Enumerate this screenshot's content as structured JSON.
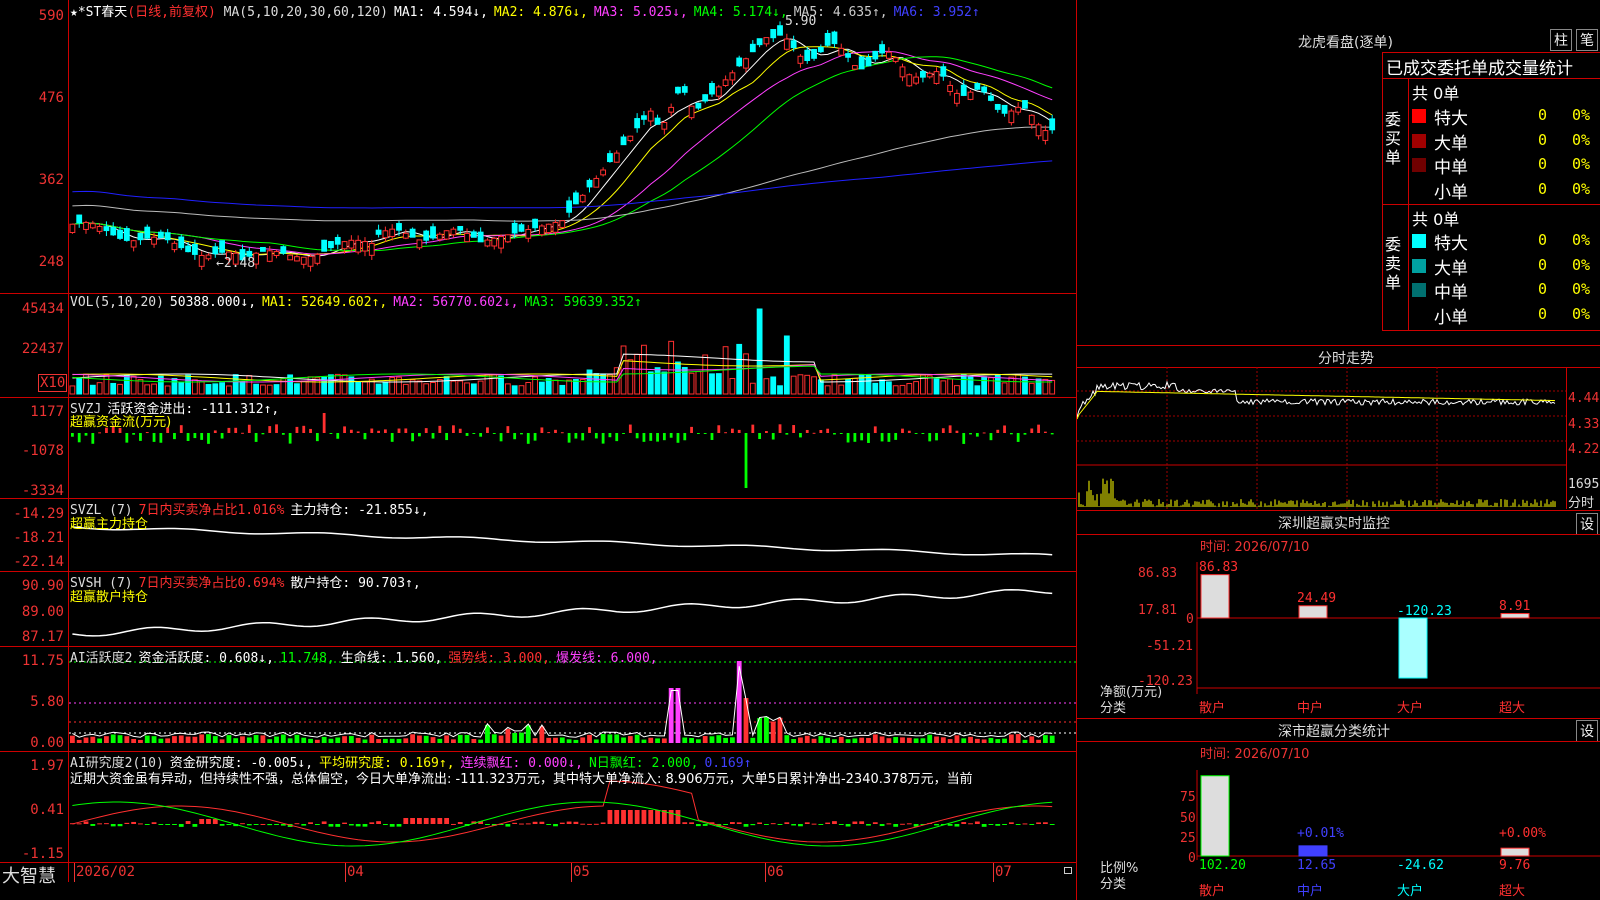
{
  "stock": {
    "name": "★*ST春天",
    "period": "(日线,前复权)",
    "ma_legend": [
      {
        "label": "MA(5,10,20,30,60,120)",
        "color": "#dddddd"
      },
      {
        "label": "MA1: 4.594↓,",
        "color": "#ffffff"
      },
      {
        "label": "MA2: 4.876↓,",
        "color": "#ffff00"
      },
      {
        "label": "MA3: 5.025↓,",
        "color": "#ff40ff"
      },
      {
        "label": "MA4: 5.174↓,",
        "color": "#00ff00"
      },
      {
        "label": "MA5: 4.635↑,",
        "color": "#cccccc"
      },
      {
        "label": "MA6: 3.952↑",
        "color": "#4040ff"
      }
    ],
    "price_axis": [
      "590",
      "476",
      "362",
      "248"
    ],
    "high_marker": "5.90",
    "low_marker": "←2.48"
  },
  "vol": {
    "axis": [
      "45434",
      "22437"
    ],
    "unit": "X10",
    "legend": [
      {
        "label": "VOL(5,10,20)",
        "color": "#dddddd"
      },
      {
        "label": "50388.000↓,",
        "color": "#ffffff"
      },
      {
        "label": "MA1: 52649.602↑,",
        "color": "#ffff00"
      },
      {
        "label": "MA2: 56770.602↓,",
        "color": "#ff40ff"
      },
      {
        "label": "MA3: 59639.352↑",
        "color": "#00ff00"
      }
    ]
  },
  "svzj": {
    "axis": [
      "1177",
      "-1078",
      "-3334"
    ],
    "legend_line1": [
      {
        "label": "SVZJ",
        "color": "#dddddd"
      },
      {
        "label": "活跃资金进出: -111.312↑,",
        "color": "#ffffff"
      }
    ],
    "legend_line2": "超赢资金流(万元)"
  },
  "svzl": {
    "axis": [
      "-14.29",
      "-18.21",
      "-22.14"
    ],
    "legend_line1": [
      {
        "label": "SVZL (7)",
        "color": "#dddddd"
      },
      {
        "label": "7日内买卖净占比1.016%",
        "color": "#ff3030"
      },
      {
        "label": "主力持仓: -21.855↓,",
        "color": "#ffffff"
      }
    ],
    "legend_line2": "超赢主力持仓"
  },
  "svsh": {
    "axis": [
      "90.90",
      "89.00",
      "87.17"
    ],
    "legend_line1": [
      {
        "label": "SVSH (7)",
        "color": "#dddddd"
      },
      {
        "label": "7日内买卖净占比0.694%",
        "color": "#ff3030"
      },
      {
        "label": "散户持仓: 90.703↑,",
        "color": "#ffffff"
      }
    ],
    "legend_line2": "超赢散户持仓"
  },
  "ai_active": {
    "axis": [
      "11.75",
      "5.80",
      "0.00"
    ],
    "legend": [
      {
        "label": "AI活跃度2",
        "color": "#dddddd"
      },
      {
        "label": "资金活跃度: 0.608↓,",
        "color": "#ffffff"
      },
      {
        "label": "11.748,",
        "color": "#00ff00"
      },
      {
        "label": "生命线: 1.560,",
        "color": "#ffffff"
      },
      {
        "label": "强势线: 3.000,",
        "color": "#ff3030"
      },
      {
        "label": "爆发线: 6.000,",
        "color": "#ff40ff"
      }
    ]
  },
  "ai_research": {
    "axis": [
      "1.97",
      "0.41",
      "-1.15"
    ],
    "legend": [
      {
        "label": "AI研究度2(10)",
        "color": "#dddddd"
      },
      {
        "label": "资金研究度: -0.005↓,",
        "color": "#ffffff"
      },
      {
        "label": "平均研究度: 0.169↑,",
        "color": "#ffff00"
      },
      {
        "label": "连续飘红: 0.000↓,",
        "color": "#ff40ff"
      },
      {
        "label": "N日飘红: 2.000,",
        "color": "#00ff00"
      },
      {
        "label": "0.169↑",
        "color": "#4040ff"
      }
    ],
    "comment": "近期大资金虽有异动，但持续性不强，总体偏空，今日大单净流出: -111.323万元，其中特大单净流入: 8.906万元，大单5日累计净出-2340.378万元，当前"
  },
  "date_axis": [
    "2026/02",
    "04",
    "05",
    "06",
    "07"
  ],
  "brand": "大智慧",
  "right_panel": {
    "lhb": {
      "title": "龙虎看盘(逐单)",
      "btn_bar": "柱",
      "btn_tick": "笔",
      "tabs": "已成交委托单成交量统计",
      "buy": {
        "side_label": "委买单",
        "total": "共 0单",
        "rows": [
          {
            "label": "特大",
            "color": "#ff0000",
            "count": "0",
            "pct": "0%"
          },
          {
            "label": "大单",
            "color": "#a00000",
            "count": "0",
            "pct": "0%"
          },
          {
            "label": "中单",
            "color": "#700000",
            "count": "0",
            "pct": "0%"
          },
          {
            "label": "小单",
            "color": "#000000",
            "count": "0",
            "pct": "0%"
          }
        ]
      },
      "sell": {
        "side_label": "委卖单",
        "total": "共 0单",
        "rows": [
          {
            "label": "特大",
            "color": "#00ffff",
            "count": "0",
            "pct": "0%"
          },
          {
            "label": "大单",
            "color": "#00a0a0",
            "count": "0",
            "pct": "0%"
          },
          {
            "label": "中单",
            "color": "#007070",
            "count": "0",
            "pct": "0%"
          },
          {
            "label": "小单",
            "color": "#000000",
            "count": "0",
            "pct": "0%"
          }
        ]
      }
    },
    "intraday": {
      "title": "分时走势",
      "price_labels": [
        "4.440",
        "4.330",
        "4.220"
      ],
      "vol_label": "1695",
      "vol_unit": "分时"
    },
    "monitor": {
      "title": "深圳超赢实时监控",
      "btn": "设",
      "time": "时间: 2026/07/10",
      "axis": [
        "86.83",
        "17.81",
        "0",
        "-51.21",
        "-120.23"
      ],
      "y_title1": "净额(万元)",
      "y_title2": "分类",
      "categories": [
        "散户",
        "中户",
        "大户",
        "超大"
      ],
      "values": [
        "86.83",
        "24.49",
        "-120.23",
        "8.91"
      ]
    },
    "classify": {
      "title": "深市超赢分类统计",
      "btn": "设",
      "time": "时间: 2026/07/10",
      "axis": [
        "75",
        "50",
        "25",
        "0"
      ],
      "y_title1": "比例%",
      "y_title2": "分类",
      "categories": [
        "散户",
        "中户",
        "大户",
        "超大"
      ],
      "values": [
        "102.20",
        "12.65",
        "-24.62",
        "9.76"
      ],
      "bar_labels": [
        "+0.01%",
        "+0.00%"
      ]
    }
  }
}
